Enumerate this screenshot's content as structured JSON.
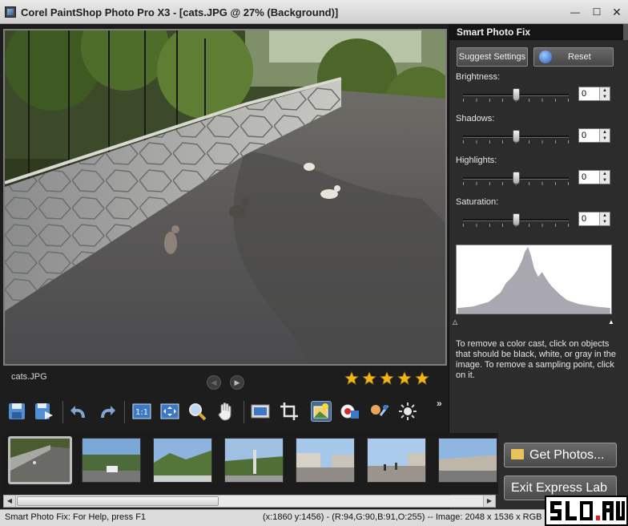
{
  "window": {
    "title": "Corel PaintShop Photo Pro X3 - [cats.JPG @  27% (Background)]",
    "minimize_glyph": "—",
    "maximize_glyph": "☐",
    "close_glyph": "✕"
  },
  "preview": {
    "filename": "cats.JPG",
    "prev_glyph": "◀",
    "next_glyph": "▶",
    "rating": 5,
    "rating_max": 5
  },
  "panel": {
    "title": "Smart Photo Fix",
    "suggest_label": "Suggest Settings",
    "reset_label": "Reset",
    "sliders": [
      {
        "label": "Brightness:",
        "value": "0",
        "level": 0.5
      },
      {
        "label": "Shadows:",
        "value": "0",
        "level": 0.5
      },
      {
        "label": "Highlights:",
        "value": "0",
        "level": 0.5
      },
      {
        "label": "Saturation:",
        "value": "0",
        "level": 0.5
      }
    ],
    "spin_up": "▲",
    "spin_down": "▼",
    "marker_black": "△",
    "marker_white": "▲",
    "help_text": "To remove a color cast, click on objects that should be black, white, or gray in the image. To remove a sampling point, click on it."
  },
  "toolbar": {
    "items": [
      "save-icon",
      "save-as-icon",
      "undo-icon",
      "redo-icon",
      "actual-size-icon",
      "fit-window-icon",
      "zoom-icon",
      "pan-hand-icon",
      "full-screen-icon",
      "crop-icon",
      "smart-photo-fix-icon",
      "red-eye-icon",
      "makeover-icon",
      "fill-light-icon"
    ],
    "more_glyph": "»"
  },
  "filmstrip": {
    "thumbnails": [
      "cats",
      "road-trucks",
      "trees-mountain",
      "monument-trees",
      "promenade-buildings",
      "promenade-people",
      "harbor-buildings"
    ],
    "selected_index": 0,
    "get_photos_label": "Get Photos...",
    "exit_label": "Exit Express Lab"
  },
  "scrollbar": {
    "left_glyph": "◀",
    "right_glyph": "▶"
  },
  "status": {
    "left": "Smart Photo Fix: For Help, press F1",
    "right": "(x:1860 y:1456) - (R:94,G:90,B:91,O:255) -- Image:  2048 x 1536 x RGB"
  },
  "watermark": {
    "text": "SLO.RU"
  },
  "colors": {
    "accent_blue": "#4a6a8d",
    "star_gold": "#f2b51a",
    "panel_bg": "#2c2c2c"
  }
}
